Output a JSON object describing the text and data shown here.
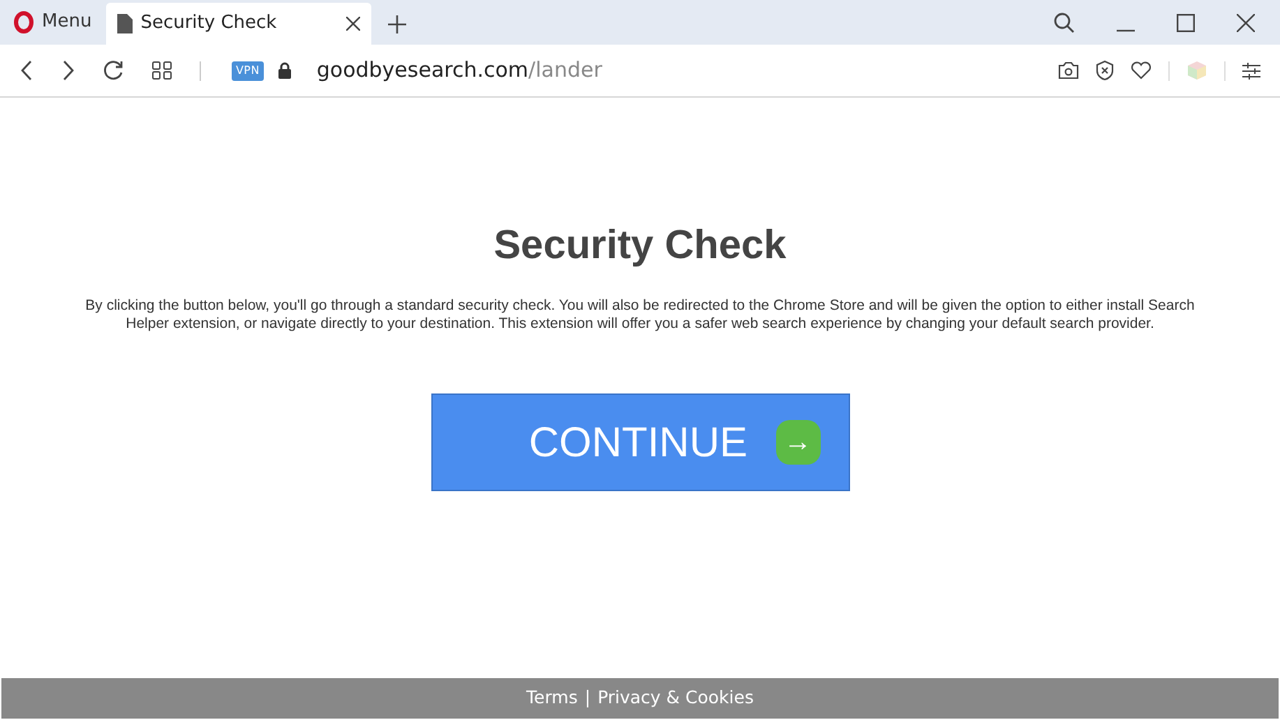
{
  "browser": {
    "menu_label": "Menu",
    "tabs": [
      {
        "title": "Security Check",
        "selected": true
      }
    ],
    "address": {
      "vpn_badge": "VPN",
      "domain": "goodbyesearch.com",
      "path": "/lander"
    }
  },
  "page": {
    "heading": "Security Check",
    "description": "By clicking the button below, you'll go through a standard security check. You will also be redirected to the Chrome Store and will be given the option to either install Search Helper extension, or navigate directly to your destination. This extension will offer you a safer web search experience by changing your default search provider.",
    "button": {
      "label": "CONTINUE",
      "arrow": "→"
    }
  },
  "footer": {
    "links": [
      "Terms",
      "Privacy & Cookies"
    ],
    "separator": "|"
  }
}
